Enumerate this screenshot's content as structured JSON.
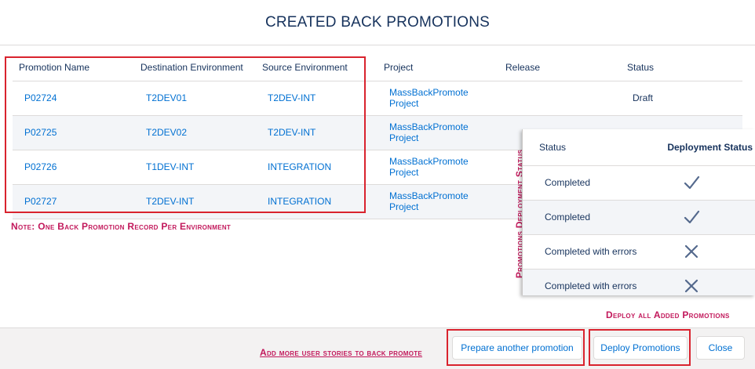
{
  "modal": {
    "title": "CREATED BACK PROMOTIONS"
  },
  "table": {
    "headers": [
      "Promotion Name",
      "Destination Environment",
      "Source Environment",
      "Project",
      "Release",
      "Status"
    ],
    "rows": [
      {
        "promotion": "P02724",
        "destination": "T2DEV01",
        "source": "T2DEV-INT",
        "project": "MassBackPromote Project",
        "release": "",
        "status": "Draft"
      },
      {
        "promotion": "P02725",
        "destination": "T2DEV02",
        "source": "T2DEV-INT",
        "project": "MassBackPromote Project",
        "release": "",
        "status": ""
      },
      {
        "promotion": "P02726",
        "destination": "T1DEV-INT",
        "source": "INTEGRATION",
        "project": "MassBackPromote Project",
        "release": "",
        "status": ""
      },
      {
        "promotion": "P02727",
        "destination": "T2DEV-INT",
        "source": "INTEGRATION",
        "project": "MassBackPromote Project",
        "release": "",
        "status": ""
      }
    ]
  },
  "annotations": {
    "note": "Note: One Back Promotion Record Per Environment",
    "vertical": "Promotions Deployment Status",
    "deploy_all": "Deploy all Added Promotions",
    "add_more": "Add more user stories to back promote"
  },
  "overlay": {
    "headers": [
      "Status",
      "Deployment Status"
    ],
    "rows": [
      {
        "status": "Completed",
        "icon": "check-icon"
      },
      {
        "status": "Completed",
        "icon": "check-icon"
      },
      {
        "status": "Completed with errors",
        "icon": "x-icon"
      },
      {
        "status": "Completed with errors",
        "icon": "x-icon"
      }
    ]
  },
  "footer": {
    "prepare_label": "Prepare another promotion",
    "deploy_label": "Deploy Promotions",
    "close_label": "Close"
  },
  "colors": {
    "link": "#0070d2",
    "text": "#16325c",
    "highlight_red": "#d9232e",
    "annotation_pink": "#c2185b",
    "footer_bg": "#f3f2f2",
    "icon": "#54698d"
  }
}
